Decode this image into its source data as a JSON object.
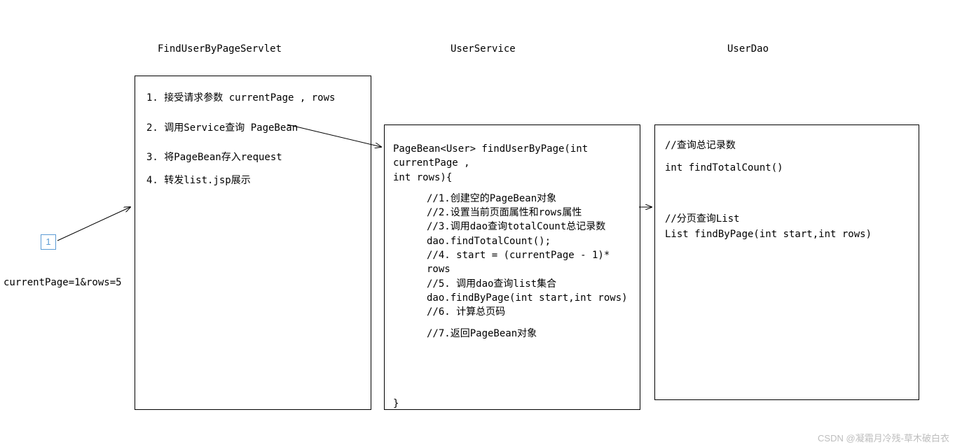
{
  "titles": {
    "servlet": "FindUserByPageServlet",
    "service": "UserService",
    "dao": "UserDao"
  },
  "page_button": "1",
  "param_text": "currentPage=1&rows=5",
  "servlet_steps": {
    "s1": "1. 接受请求参数 currentPage , rows",
    "s2": "2. 调用Service查询 PageBean",
    "s3": "3. 将PageBean存入request",
    "s4": "4. 转发list.jsp展示"
  },
  "service_method": {
    "sig1": "PageBean<User> findUserByPage(int currentPage ,",
    "sig2": "int rows){",
    "b1": "//1.创建空的PageBean对象",
    "b2": "//2.设置当前页面属性和rows属性",
    "b3": "//3.调用dao查询totalCount总记录数",
    "b4": "dao.findTotalCount();",
    "b5": "//4. start = (currentPage - 1)* rows",
    "b6": "//5. 调用dao查询list集合",
    "b7": "dao.findByPage(int start,int rows)",
    "b8": "//6. 计算总页码",
    "b9": "//7.返回PageBean对象",
    "close": "}"
  },
  "dao_lines": {
    "d1": "//查询总记录数",
    "d2": "int findTotalCount()",
    "d3": "//分页查询List",
    "d4": "List findByPage(int start,int rows)"
  },
  "watermark": "CSDN @凝霜月冷残-草木破白衣"
}
